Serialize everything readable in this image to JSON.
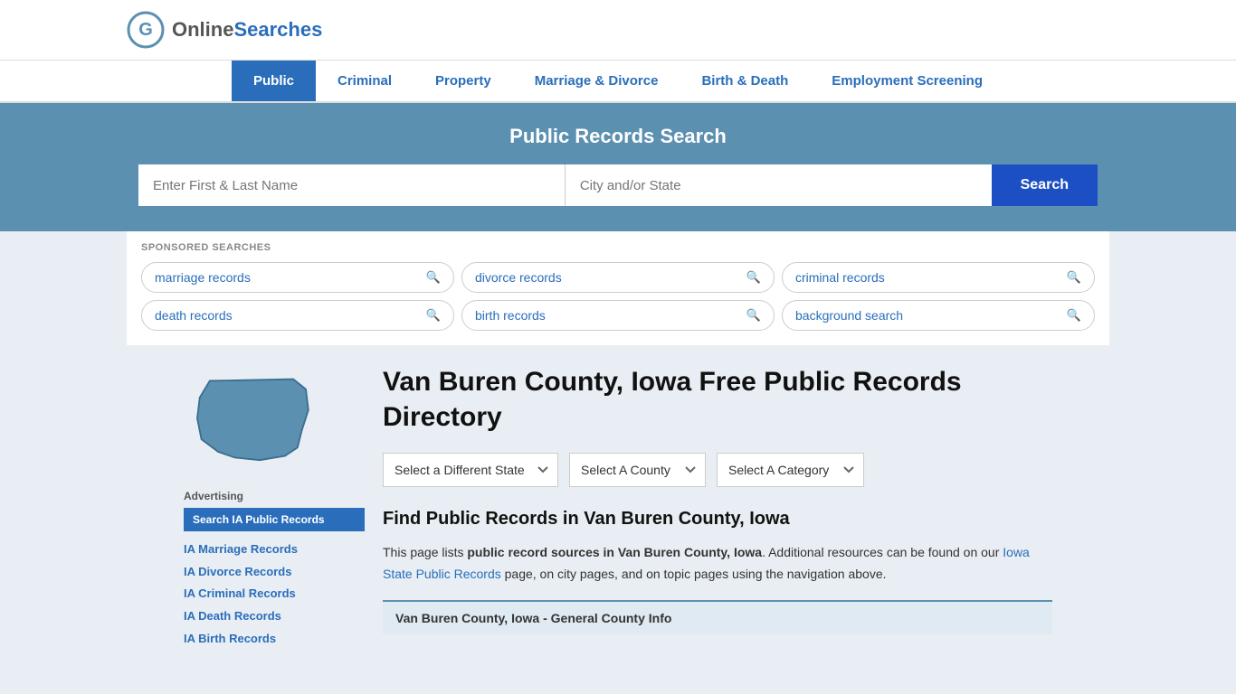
{
  "site": {
    "logo_online": "Online",
    "logo_searches": "Searches",
    "logo_icon_alt": "OnlineSearches logo"
  },
  "nav": {
    "items": [
      {
        "label": "Public",
        "active": true
      },
      {
        "label": "Criminal",
        "active": false
      },
      {
        "label": "Property",
        "active": false
      },
      {
        "label": "Marriage & Divorce",
        "active": false
      },
      {
        "label": "Birth & Death",
        "active": false
      },
      {
        "label": "Employment Screening",
        "active": false
      }
    ]
  },
  "hero": {
    "title": "Public Records Search",
    "name_placeholder": "Enter First & Last Name",
    "location_placeholder": "City and/or State",
    "search_button": "Search"
  },
  "sponsored": {
    "label": "Sponsored Searches",
    "tags": [
      "marriage records",
      "divorce records",
      "criminal records",
      "death records",
      "birth records",
      "background search"
    ]
  },
  "sidebar": {
    "advertising_label": "Advertising",
    "highlight_button": "Search IA Public Records",
    "links": [
      "IA Marriage Records",
      "IA Divorce Records",
      "IA Criminal Records",
      "IA Death Records",
      "IA Birth Records"
    ]
  },
  "dropdowns": {
    "state": "Select a Different State",
    "county": "Select A County",
    "category": "Select A Category"
  },
  "content": {
    "county_title": "Van Buren County, Iowa Free Public Records Directory",
    "find_title": "Find Public Records in Van Buren County, Iowa",
    "description_part1": "This page lists ",
    "description_bold": "public record sources in Van Buren County, Iowa",
    "description_part2": ". Additional resources can be found on our ",
    "description_link": "Iowa State Public Records",
    "description_part3": " page, on city pages, and on topic pages using the navigation above.",
    "county_info_label": "Van Buren County, Iowa - General County Info"
  }
}
